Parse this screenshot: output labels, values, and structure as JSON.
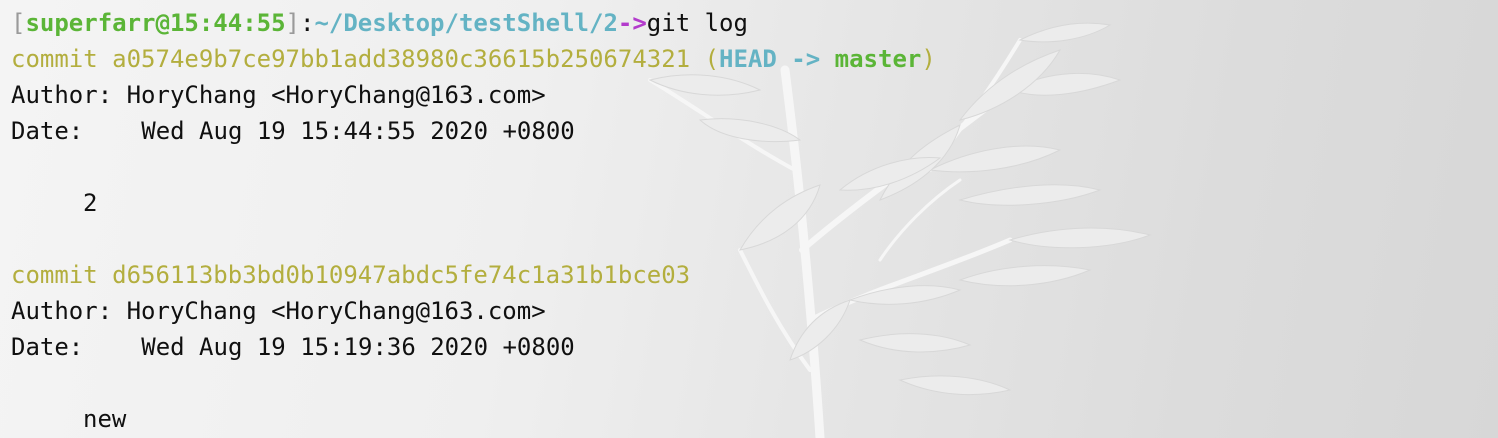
{
  "prompt": {
    "open_bracket": "[",
    "user_host_time": "superfarr@15:44:55",
    "close_bracket": "]",
    "colon": ":",
    "path": "~/Desktop/testShell/2",
    "arrow": "->",
    "command": "git log"
  },
  "commits": [
    {
      "label": "commit",
      "hash": "a0574e9b7ce97bb1add38980c36615b250674321",
      "refs_open": "(",
      "head": "HEAD",
      "arrow": "->",
      "branch": "master",
      "refs_close": ")",
      "author_label": "Author:",
      "author": "HoryChang <HoryChang@163.com>",
      "date_label": "Date:",
      "date": "Wed Aug 19 15:44:55 2020 +0800",
      "message": "2"
    },
    {
      "label": "commit",
      "hash": "d656113bb3bd0b10947abdc5fe74c1a31b1bce03",
      "author_label": "Author:",
      "author": "HoryChang <HoryChang@163.com>",
      "date_label": "Date:",
      "date": "Wed Aug 19 15:19:36 2020 +0800",
      "message": "new"
    }
  ],
  "colors": {
    "prompt_user": "#5bb537",
    "prompt_path": "#64b3c4",
    "prompt_arrow": "#b33bcc",
    "commit_hash": "#b3ae3e",
    "text": "#101010"
  }
}
